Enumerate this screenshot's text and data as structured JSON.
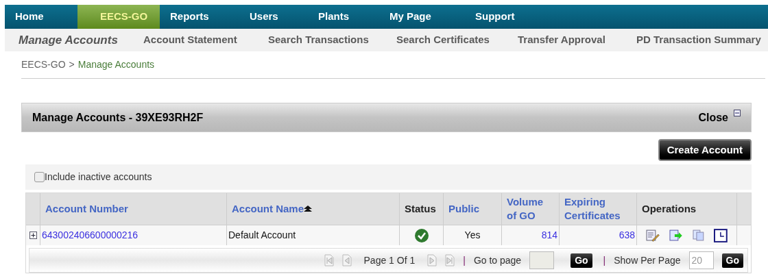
{
  "nav": {
    "items": [
      {
        "label": "Home",
        "selected": false
      },
      {
        "label": "EECS-GO",
        "selected": true
      },
      {
        "label": "Reports",
        "selected": false
      },
      {
        "label": "Users",
        "selected": false
      },
      {
        "label": "Plants",
        "selected": false
      },
      {
        "label": "My Page",
        "selected": false
      },
      {
        "label": "Support",
        "selected": false
      }
    ]
  },
  "subnav": {
    "items": [
      {
        "label": "Manage Accounts",
        "selected": true
      },
      {
        "label": "Account Statement",
        "selected": false
      },
      {
        "label": "Search Transactions",
        "selected": false
      },
      {
        "label": "Search Certificates",
        "selected": false
      },
      {
        "label": "Transfer Approval",
        "selected": false
      },
      {
        "label": "PD Transaction Summary",
        "selected": false
      }
    ]
  },
  "breadcrumb": [
    "EECS-GO",
    ">",
    "Manage Accounts"
  ],
  "panel": {
    "title": "Manage Accounts - 39XE93RH2F",
    "close": "Close",
    "create_button": "Create Account",
    "include_inactive": {
      "label": "Include inactive accounts",
      "checked": false
    }
  },
  "table": {
    "columns": [
      {
        "label": "Account Number",
        "kind": "link",
        "sorted": false
      },
      {
        "label": "Account Name",
        "kind": "link",
        "sorted": true
      },
      {
        "label": "Status",
        "kind": "plain",
        "sorted": false
      },
      {
        "label": "Public",
        "kind": "link",
        "sorted": false
      },
      {
        "label": "Volume of GO",
        "kind": "link",
        "sorted": false
      },
      {
        "label": "Expiring Certificates",
        "kind": "link",
        "sorted": false
      },
      {
        "label": "Operations",
        "kind": "plain",
        "sorted": false
      }
    ],
    "rows": [
      {
        "expanded": false,
        "account_number": "643002406600000216",
        "account_name": "Default Account",
        "status_ok": true,
        "public": "Yes",
        "volume": "814",
        "expiring": "638"
      }
    ]
  },
  "pager": {
    "page_label": "Page 1 Of 1",
    "separator_1": "|",
    "go_to_label": "Go to page",
    "go_button": "Go",
    "separator_2": "|",
    "per_page_label": "Show Per Page",
    "per_page": "20",
    "per_page_button": "Go"
  }
}
